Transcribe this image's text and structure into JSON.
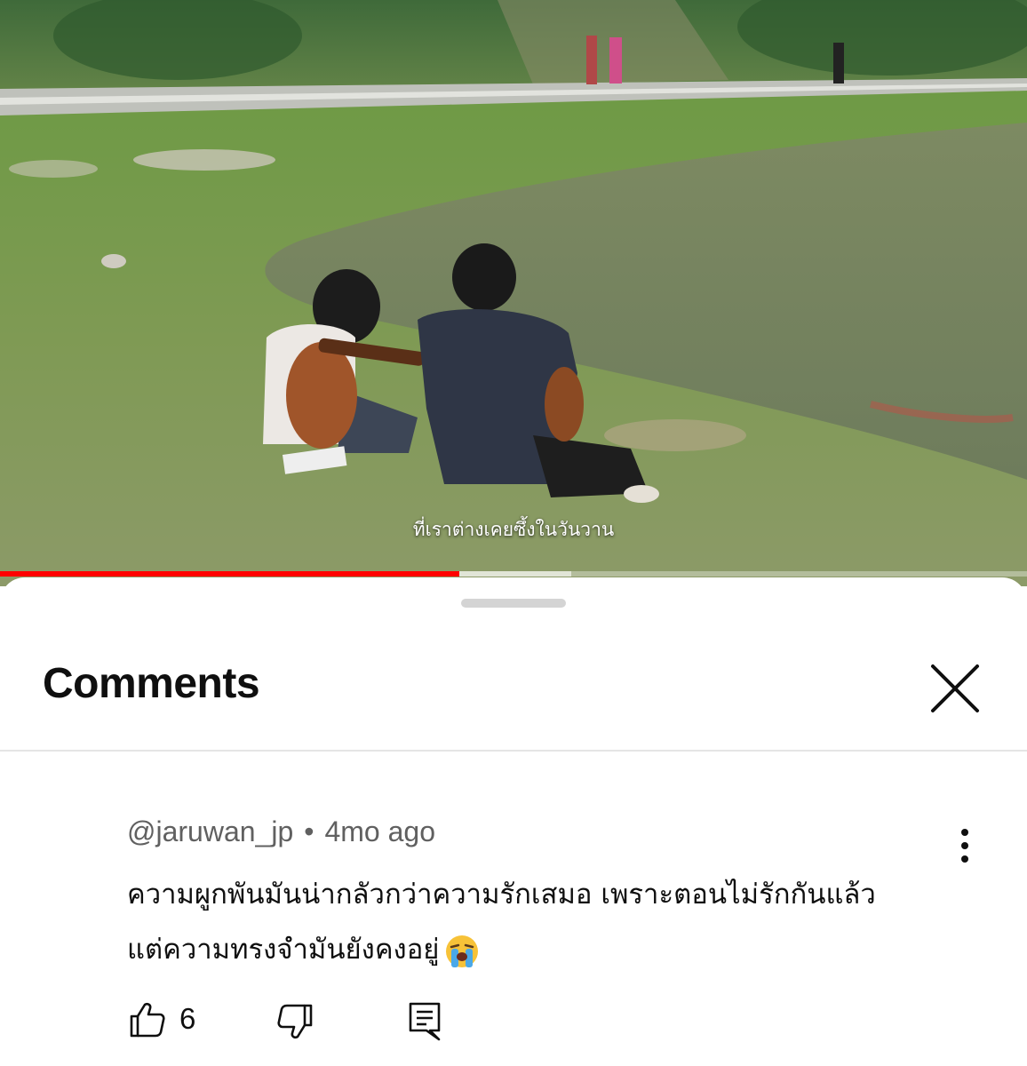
{
  "video": {
    "subtitle": "ที่เราต่างเคยซึ้งในวันวาน",
    "progress_played": 0.447,
    "progress_buffered": 0.556
  },
  "comments_panel": {
    "title": "Comments"
  },
  "comment": {
    "author": "@jaruwan_jp",
    "separator": "•",
    "time": "4mo ago",
    "text_line1": "ความผูกพันมันน่ากลัวกว่าความรักเสมอ เพราะตอนไม่รักกันแล้ว",
    "text_line2": "แต่ความทรงจำมันยังคงอยู่",
    "emoji": "loudly-crying-face",
    "like_count": "6"
  },
  "icons": {
    "close": "close-icon",
    "more": "more-vert-icon",
    "like": "thumb-up-icon",
    "dislike": "thumb-down-icon",
    "reply": "reply-icon"
  },
  "colors": {
    "progress_red": "#ff0000",
    "text_primary": "#0f0f0f",
    "text_secondary": "#606060"
  }
}
